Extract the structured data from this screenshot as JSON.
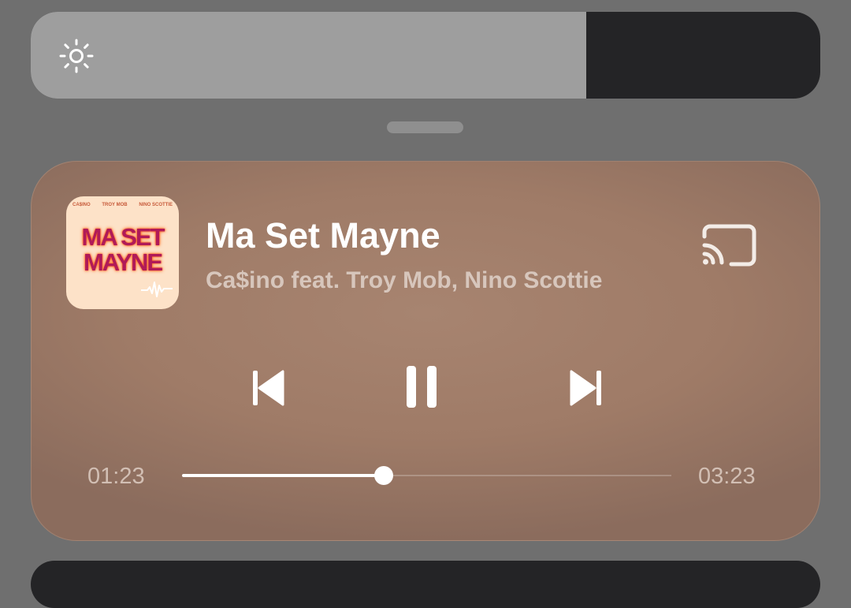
{
  "brightness": {
    "level": 0.704,
    "icon": "sun-icon"
  },
  "media_player": {
    "album_art": {
      "credits": [
        "CA$INO",
        "TROY MOB",
        "NINO SCOTTIE"
      ],
      "title_line_1": "MA SET",
      "title_line_2": "MAYNE"
    },
    "title": "Ma Set Mayne",
    "artist": "Ca$ino feat. Troy Mob, Nino Scottie",
    "cast_icon": "cast-icon",
    "controls": {
      "previous_icon": "skip-previous-icon",
      "pause_icon": "pause-icon",
      "next_icon": "skip-next-icon"
    },
    "elapsed": "01:23",
    "duration": "03:23",
    "progress": 0.412,
    "colors": {
      "card": "#a78470",
      "subtitle": "#d7c6bc"
    }
  }
}
